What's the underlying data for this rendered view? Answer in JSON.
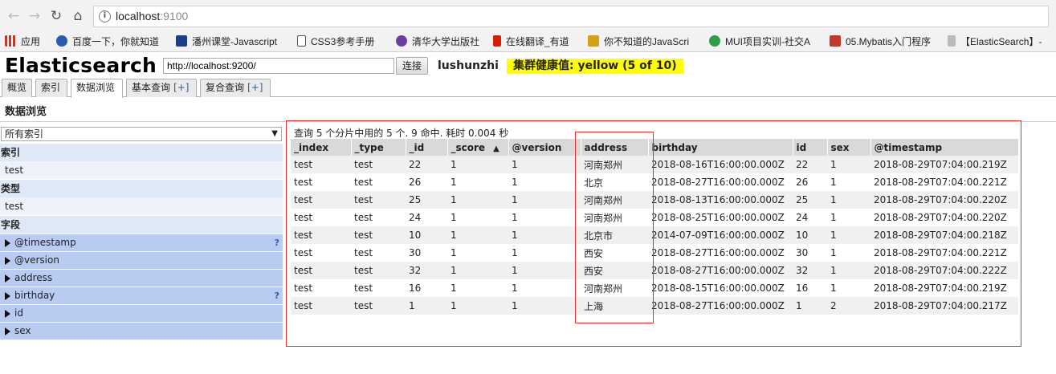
{
  "browser": {
    "url_host": "localhost",
    "url_port": ":9100",
    "bookmarks": [
      {
        "label": "应用",
        "color": "#c0392b"
      },
      {
        "label": "百度一下，你就知道",
        "color": "#2a5db0"
      },
      {
        "label": "潘州课堂-Javascript",
        "color": "#1b3f8b"
      },
      {
        "label": "CSS3参考手册",
        "color": "#ffffff"
      },
      {
        "label": "清华大学出版社",
        "color": "#6b3fa0"
      },
      {
        "label": "在线翻译_有道",
        "color": "#d81e06"
      },
      {
        "label": "你不知道的JavaScri",
        "color": "#d4a017"
      },
      {
        "label": "MUI项目实训-社交A",
        "color": "#2e9e44"
      },
      {
        "label": "05.Mybatis入门程序",
        "color": "#c0392b"
      },
      {
        "label": "【ElasticSearch】-",
        "color": "#555555"
      }
    ]
  },
  "header": {
    "title": "Elasticsearch",
    "connect_url": "http://localhost:9200/",
    "connect_label": "连接",
    "cluster_name": "lushunzhi",
    "health": "集群健康值: yellow (5 of 10)",
    "health_color": "#ffff00"
  },
  "tabs": [
    {
      "label": "概览",
      "plus": ""
    },
    {
      "label": "索引",
      "plus": ""
    },
    {
      "label": "数据浏览",
      "plus": ""
    },
    {
      "label": "基本查询",
      "plus": "[+]"
    },
    {
      "label": "复合查询",
      "plus": "[+]"
    }
  ],
  "section_title": "数据浏览",
  "sidebar": {
    "index_select": "所有索引",
    "index_head": "索引",
    "index_item": "test",
    "type_head": "类型",
    "type_item": "test",
    "field_head": "字段",
    "fields": [
      {
        "name": "@timestamp",
        "hint": "?"
      },
      {
        "name": "@version",
        "hint": ""
      },
      {
        "name": "address",
        "hint": ""
      },
      {
        "name": "birthday",
        "hint": "?"
      },
      {
        "name": "id",
        "hint": ""
      },
      {
        "name": "sex",
        "hint": ""
      }
    ]
  },
  "results": {
    "summary": "查询 5 个分片中用的 5 个. 9 命中. 耗时 0.004 秒",
    "columns": [
      "_index",
      "_type",
      "_id",
      "_score",
      "@version",
      "address",
      "birthday",
      "id",
      "sex",
      "@timestamp"
    ],
    "sort_column": "_score",
    "sort_indicator": "▲",
    "rows": [
      [
        "test",
        "test",
        "22",
        "1",
        "1",
        "河南郑州",
        "2018-08-16T16:00:00.000Z",
        "22",
        "1",
        "2018-08-29T07:04:00.219Z"
      ],
      [
        "test",
        "test",
        "26",
        "1",
        "1",
        "北京",
        "2018-08-27T16:00:00.000Z",
        "26",
        "1",
        "2018-08-29T07:04:00.221Z"
      ],
      [
        "test",
        "test",
        "25",
        "1",
        "1",
        "河南郑州",
        "2018-08-13T16:00:00.000Z",
        "25",
        "1",
        "2018-08-29T07:04:00.220Z"
      ],
      [
        "test",
        "test",
        "24",
        "1",
        "1",
        "河南郑州",
        "2018-08-25T16:00:00.000Z",
        "24",
        "1",
        "2018-08-29T07:04:00.220Z"
      ],
      [
        "test",
        "test",
        "10",
        "1",
        "1",
        "北京市",
        "2014-07-09T16:00:00.000Z",
        "10",
        "1",
        "2018-08-29T07:04:00.218Z"
      ],
      [
        "test",
        "test",
        "30",
        "1",
        "1",
        "西安",
        "2018-08-27T16:00:00.000Z",
        "30",
        "1",
        "2018-08-29T07:04:00.221Z"
      ],
      [
        "test",
        "test",
        "32",
        "1",
        "1",
        "西安",
        "2018-08-27T16:00:00.000Z",
        "32",
        "1",
        "2018-08-29T07:04:00.222Z"
      ],
      [
        "test",
        "test",
        "16",
        "1",
        "1",
        "河南郑州",
        "2018-08-15T16:00:00.000Z",
        "16",
        "1",
        "2018-08-29T07:04:00.219Z"
      ],
      [
        "test",
        "test",
        "1",
        "1",
        "1",
        "上海",
        "2018-08-27T16:00:00.000Z",
        "1",
        "2",
        "2018-08-29T07:04:00.217Z"
      ]
    ]
  },
  "icons": {
    "back": "←",
    "forward": "→",
    "reload": "↻",
    "home": "⌂",
    "info": "i",
    "dropdown": "▼"
  }
}
